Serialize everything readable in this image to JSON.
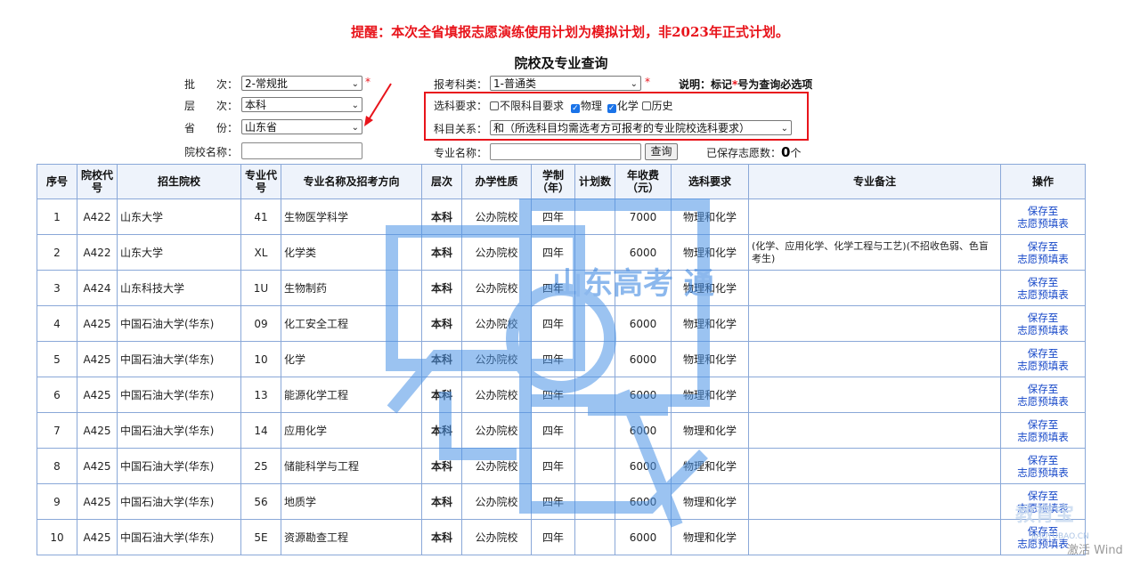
{
  "header": {
    "notice": "提醒：本次全省填报志愿演练使用计划为模拟计划，非2023年正式计划。",
    "title": "院校及专业查询",
    "required_note_prefix": "说明：标记",
    "required_note_star": "*",
    "required_note_suffix": "号为查询必选项"
  },
  "form": {
    "batch_label": "批　　次：",
    "batch_value": "2-常规批",
    "level_label": "层　　次：",
    "level_value": "本科",
    "province_label": "省　　份：",
    "province_value": "山东省",
    "school_name_label": "院校名称：",
    "category_label": "报考科类：",
    "category_value": "1-普通类",
    "subject_req_label": "选科要求：",
    "subject_options": [
      {
        "label": "不限科目要求",
        "checked": false
      },
      {
        "label": "物理",
        "checked": true
      },
      {
        "label": "化学",
        "checked": true
      },
      {
        "label": "历史",
        "checked": false
      }
    ],
    "relation_label": "科目关系：",
    "relation_value": "和（所选科目均需选考方可报考的专业院校选科要求）",
    "major_name_label": "专业名称：",
    "query_button": "查询",
    "saved_label": "已保存志愿数：",
    "saved_count": "0",
    "saved_unit": "个",
    "required_star": "*"
  },
  "table": {
    "headers": [
      "序号",
      "院校代号",
      "招生院校",
      "专业代号",
      "专业名称及招考方向",
      "层次",
      "办学性质",
      "学制（年）",
      "计划数",
      "年收费（元）",
      "选科要求",
      "专业备注",
      "操作"
    ],
    "action_label": "保存至志愿预填表",
    "rows": [
      {
        "no": "1",
        "code": "A422",
        "school": "山东大学",
        "major_code": "41",
        "major": "生物医学科学",
        "level": "本科",
        "nature": "公办院校",
        "years": "四年",
        "plan": "",
        "fee": "7000",
        "req": "物理和化学",
        "remark": ""
      },
      {
        "no": "2",
        "code": "A422",
        "school": "山东大学",
        "major_code": "XL",
        "major": "化学类",
        "level": "本科",
        "nature": "公办院校",
        "years": "四年",
        "plan": "",
        "fee": "6000",
        "req": "物理和化学",
        "remark": "(化学、应用化学、化学工程与工艺)(不招收色弱、色盲考生)"
      },
      {
        "no": "3",
        "code": "A424",
        "school": "山东科技大学",
        "major_code": "1U",
        "major": "生物制药",
        "level": "本科",
        "nature": "公办院校",
        "years": "四年",
        "plan": "",
        "fee": "",
        "req": "物理和化学",
        "remark": ""
      },
      {
        "no": "4",
        "code": "A425",
        "school": "中国石油大学(华东)",
        "major_code": "09",
        "major": "化工安全工程",
        "level": "本科",
        "nature": "公办院校",
        "years": "四年",
        "plan": "",
        "fee": "6000",
        "req": "物理和化学",
        "remark": ""
      },
      {
        "no": "5",
        "code": "A425",
        "school": "中国石油大学(华东)",
        "major_code": "10",
        "major": "化学",
        "level": "本科",
        "nature": "公办院校",
        "years": "四年",
        "plan": "",
        "fee": "6000",
        "req": "物理和化学",
        "remark": ""
      },
      {
        "no": "6",
        "code": "A425",
        "school": "中国石油大学(华东)",
        "major_code": "13",
        "major": "能源化学工程",
        "level": "本科",
        "nature": "公办院校",
        "years": "四年",
        "plan": "",
        "fee": "6000",
        "req": "物理和化学",
        "remark": ""
      },
      {
        "no": "7",
        "code": "A425",
        "school": "中国石油大学(华东)",
        "major_code": "14",
        "major": "应用化学",
        "level": "本科",
        "nature": "公办院校",
        "years": "四年",
        "plan": "",
        "fee": "6000",
        "req": "物理和化学",
        "remark": ""
      },
      {
        "no": "8",
        "code": "A425",
        "school": "中国石油大学(华东)",
        "major_code": "25",
        "major": "储能科学与工程",
        "level": "本科",
        "nature": "公办院校",
        "years": "四年",
        "plan": "",
        "fee": "6000",
        "req": "物理和化学",
        "remark": ""
      },
      {
        "no": "9",
        "code": "A425",
        "school": "中国石油大学(华东)",
        "major_code": "56",
        "major": "地质学",
        "level": "本科",
        "nature": "公办院校",
        "years": "四年",
        "plan": "",
        "fee": "6000",
        "req": "物理和化学",
        "remark": ""
      },
      {
        "no": "10",
        "code": "A425",
        "school": "中国石油大学(华东)",
        "major_code": "5E",
        "major": "资源勘查工程",
        "level": "本科",
        "nature": "公办院校",
        "years": "四年",
        "plan": "",
        "fee": "6000",
        "req": "物理和化学",
        "remark": ""
      }
    ]
  },
  "watermarks": {
    "center": "山东高考 通",
    "corner": "教育宝",
    "corner_sub": "JIAOYUBAO.CN",
    "windows": "激活 Wind"
  },
  "colors": {
    "notice_red": "#e8141b",
    "link_blue": "#1446c8",
    "table_border": "#8aa8d8",
    "header_bg": "#eef3fb"
  }
}
